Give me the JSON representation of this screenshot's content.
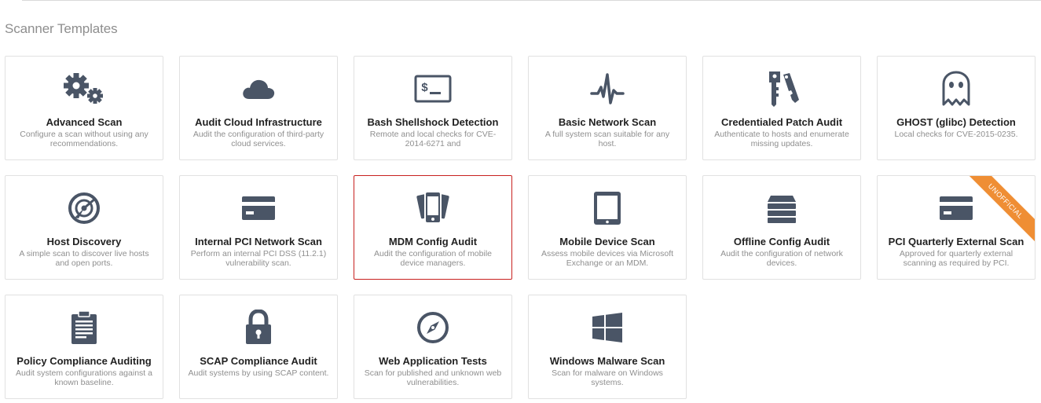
{
  "page": {
    "title": "Scanner Templates"
  },
  "colors": {
    "icon": "#4a5566",
    "selected_border": "#c8211f",
    "ribbon": "#ef8e34"
  },
  "templates": [
    {
      "title": "Advanced Scan",
      "desc": "Configure a scan without using any recommendations.",
      "icon": "gears-icon"
    },
    {
      "title": "Audit Cloud Infrastructure",
      "desc": "Audit the configuration of third-party cloud services.",
      "icon": "cloud-icon"
    },
    {
      "title": "Bash Shellshock Detection",
      "desc": "Remote and local checks for CVE-2014-6271 and",
      "icon": "terminal-icon"
    },
    {
      "title": "Basic Network Scan",
      "desc": "A full system scan suitable for any host.",
      "icon": "pulse-icon"
    },
    {
      "title": "Credentialed Patch Audit",
      "desc": "Authenticate to hosts and enumerate missing updates.",
      "icon": "keys-icon"
    },
    {
      "title": "GHOST (glibc) Detection",
      "desc": "Local checks for CVE-2015-0235.",
      "icon": "ghost-icon"
    },
    {
      "title": "Host Discovery",
      "desc": "A simple scan to discover live hosts and open ports.",
      "icon": "radar-icon"
    },
    {
      "title": "Internal PCI Network Scan",
      "desc": "Perform an internal PCI DSS (11.2.1) vulnerability scan.",
      "icon": "credit-card-icon"
    },
    {
      "title": "MDM Config Audit",
      "desc": "Audit the configuration of mobile device managers.",
      "icon": "mobile-devices-icon",
      "selected": true
    },
    {
      "title": "Mobile Device Scan",
      "desc": "Assess mobile devices via Microsoft Exchange or an MDM.",
      "icon": "tablet-icon"
    },
    {
      "title": "Offline Config Audit",
      "desc": "Audit the configuration of network devices.",
      "icon": "server-stack-icon"
    },
    {
      "title": "PCI Quarterly External Scan",
      "desc": "Approved for quarterly external scanning as required by PCI.",
      "icon": "credit-card-icon",
      "ribbon": "UNOFFICIAL"
    },
    {
      "title": "Policy Compliance Auditing",
      "desc": "Audit system configurations against a known baseline.",
      "icon": "clipboard-icon"
    },
    {
      "title": "SCAP Compliance Audit",
      "desc": "Audit systems by using SCAP content.",
      "icon": "padlock-icon"
    },
    {
      "title": "Web Application Tests",
      "desc": "Scan for published and unknown web vulnerabilities.",
      "icon": "compass-icon"
    },
    {
      "title": "Windows Malware Scan",
      "desc": "Scan for malware on Windows systems.",
      "icon": "windows-icon"
    }
  ]
}
